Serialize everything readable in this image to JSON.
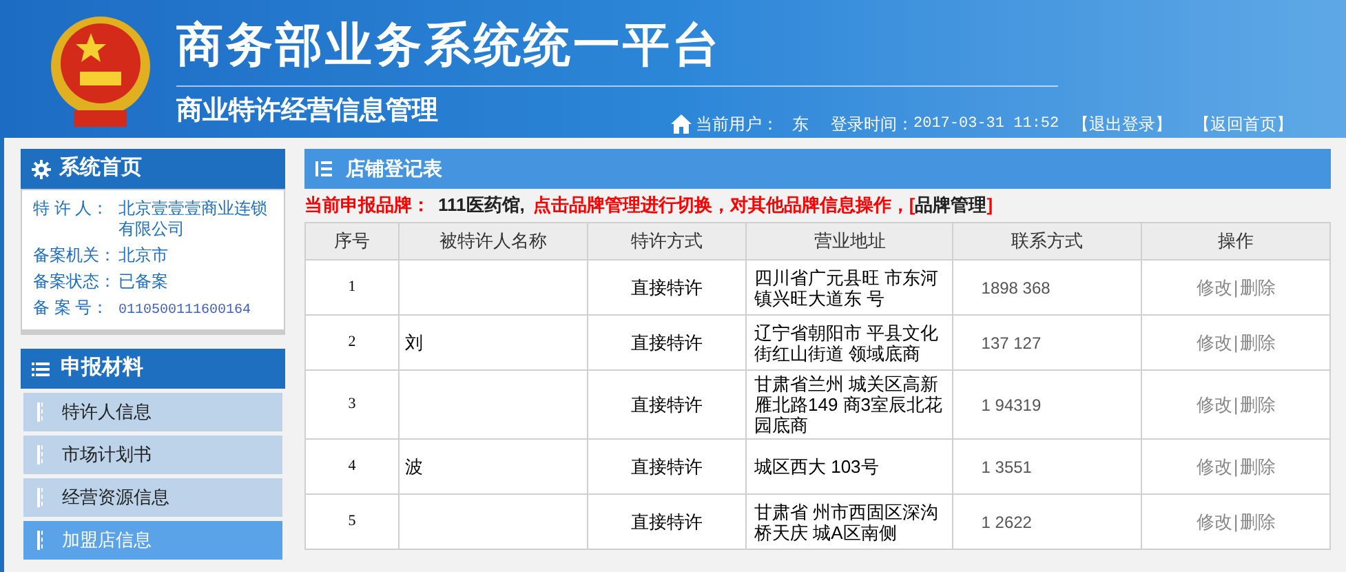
{
  "header": {
    "title": "商务部业务系统统一平台",
    "subtitle": "商业特许经营信息管理",
    "user_label": "当前用户：",
    "user_name": "东",
    "login_label": "登录时间：",
    "login_time": "2017-03-31 11:52",
    "logout": "【退出登录】",
    "home": "【返回首页】"
  },
  "sidebar": {
    "home_title": "系统首页",
    "info": [
      {
        "label": "特 许 人：",
        "value": "北京壹壹壹商业连锁有限公司",
        "kind": "text"
      },
      {
        "label": "备案机关：",
        "value": "北京市",
        "kind": "text"
      },
      {
        "label": "备案状态：",
        "value": "已备案",
        "kind": "text"
      },
      {
        "label": "备 案 号：",
        "value": "0110500111600164",
        "kind": "code"
      }
    ],
    "materials_title": "申报材料",
    "items": [
      {
        "label": "特许人信息",
        "selected": false
      },
      {
        "label": "市场计划书",
        "selected": false
      },
      {
        "label": "经营资源信息",
        "selected": false
      },
      {
        "label": "加盟店信息",
        "selected": true
      }
    ]
  },
  "main": {
    "title": "店铺登记表",
    "notice": {
      "label": "当前申报品牌：",
      "brand": "111医药馆,",
      "text": "点击品牌管理进行切换，对其他品牌信息操作，[",
      "link": "品牌管理",
      "close": "]"
    },
    "table": {
      "columns": [
        "序号",
        "被特许人名称",
        "特许方式",
        "营业地址",
        "联系方式",
        "操作"
      ],
      "action_separator": "|",
      "rows": [
        {
          "no": "1",
          "mode": "直接特许",
          "address": "四川省广元县旺 市东河镇兴旺大道东 号",
          "contact": "1898 368",
          "edit": "修改",
          "delete": "删除"
        },
        {
          "no": "2",
          "name": "刘",
          "mode": "直接特许",
          "address": "辽宁省朝阳市 平县文化街红山街道 领域底商",
          "contact": "137 127",
          "edit": "修改",
          "delete": "删除"
        },
        {
          "no": "3",
          "mode": "直接特许",
          "address": "甘肃省兰州 城关区高新雁北路149 商3室辰北花园底商",
          "contact": "1 94319",
          "edit": "修改",
          "delete": "删除"
        },
        {
          "no": "4",
          "name": "波",
          "mode": "直接特许",
          "address": "城区西大 103号",
          "contact": "1 3551",
          "edit": "修改",
          "delete": "删除"
        },
        {
          "no": "5",
          "mode": "直接特许",
          "address": "甘肃省 州市西固区深沟桥天庆 城A区南侧",
          "contact": "1 2622",
          "edit": "修改",
          "delete": "删除"
        }
      ]
    }
  }
}
